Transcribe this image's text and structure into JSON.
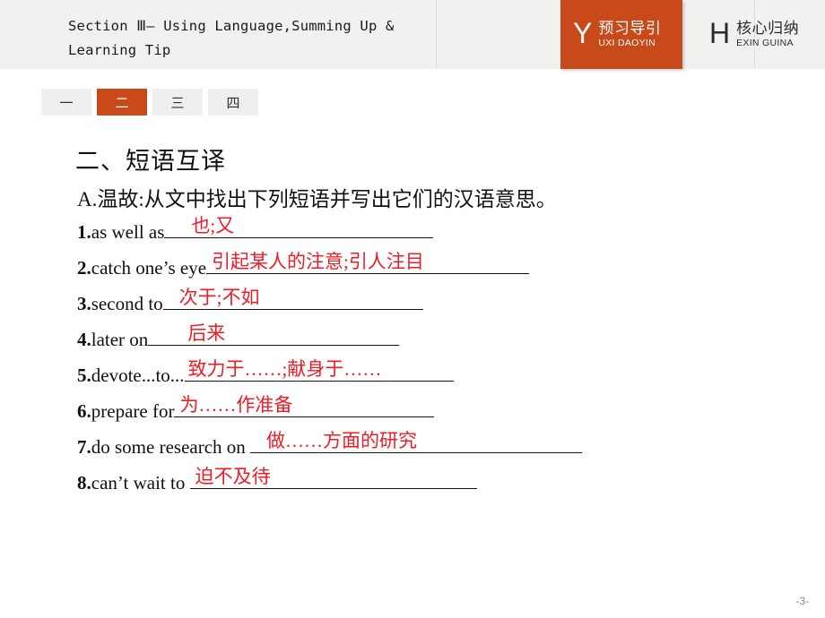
{
  "header": {
    "title": "Section Ⅲ— Using Language,Summing Up &\nLearning Tip",
    "tabs": [
      {
        "letter": "Y",
        "cn": "预习导引",
        "en": "UXI DAOYIN",
        "active": true
      },
      {
        "letter": "H",
        "cn": "核心归纳",
        "en": "EXIN GUINA",
        "active": false
      }
    ]
  },
  "nav": {
    "tabs": [
      {
        "label": "一",
        "active": false
      },
      {
        "label": "二",
        "active": true
      },
      {
        "label": "三",
        "active": false
      },
      {
        "label": "四",
        "active": false
      }
    ]
  },
  "body": {
    "section_title": "二、短语互译",
    "prompt": "A.温故:从文中找出下列短语并写出它们的汉语意思。",
    "items": [
      {
        "num": "1",
        "dot": ".",
        "phrase": "as well as",
        "answer": "也;又",
        "blank_width": 300,
        "ans_align": "left",
        "ans_pad": 30
      },
      {
        "num": "2",
        "dot": ".",
        "phrase": "catch one’s eye",
        "answer": "引起某人的注意;引人注目",
        "blank_width": 360,
        "ans_align": "left",
        "ans_pad": 6
      },
      {
        "num": "3",
        "dot": ".",
        "phrase": "second to",
        "answer": "次于;不如",
        "blank_width": 290,
        "ans_align": "left",
        "ans_pad": 18
      },
      {
        "num": "4",
        "dot": ".",
        "phrase": "later on",
        "answer": "后来",
        "blank_width": 280,
        "ans_align": "left",
        "ans_pad": 44
      },
      {
        "num": "5",
        "dot": ".",
        "phrase": "devote...to...",
        "answer": "致力于……;献身于……",
        "blank_width": 300,
        "ans_align": "left",
        "ans_pad": 4
      },
      {
        "num": "6",
        "dot": ".",
        "phrase": "prepare for",
        "answer": "为……作准备",
        "blank_width": 290,
        "ans_align": "left",
        "ans_pad": 6
      },
      {
        "num": "7",
        "dot": ".",
        "phrase": "do some research on ",
        "answer": "做……方面的研究",
        "blank_width": 370,
        "ans_align": "left",
        "ans_pad": 18
      },
      {
        "num": "8",
        "dot": ".",
        "phrase": "can’t wait to ",
        "answer": "迫不及待",
        "blank_width": 320,
        "ans_align": "left",
        "ans_pad": 6
      }
    ]
  },
  "footer": {
    "page": "-3-"
  },
  "colors": {
    "accent": "#c8491a",
    "answer_red": "#ee1c25",
    "header_bg": "#f1f1f0",
    "tab_bg": "#efefee"
  }
}
